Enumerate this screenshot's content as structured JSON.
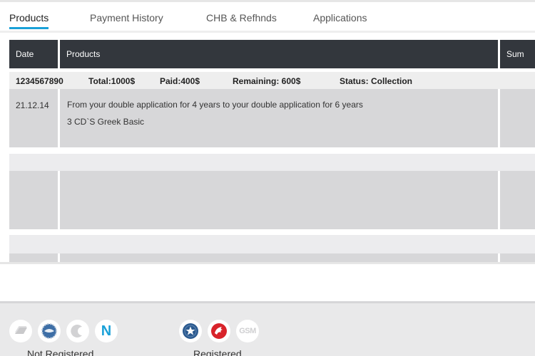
{
  "tabs": [
    {
      "label": "Products",
      "active": true
    },
    {
      "label": "Payment History",
      "active": false
    },
    {
      "label": "CHB & Refhnds",
      "active": false
    },
    {
      "label": "Applications",
      "active": false
    }
  ],
  "table": {
    "headers": {
      "date": "Date",
      "products": "Products",
      "sum": "Sum"
    },
    "summary": {
      "id": "1234567890",
      "total": "Total:1000$",
      "paid": "Paid:400$",
      "remaining": "Remaining: 600$",
      "status": "Status: Collection"
    },
    "rows": [
      {
        "date": "21.12.14",
        "line1": "From your double application for 4 years to your double application for 6 years",
        "line2": "3 CD`S Greek Basic"
      }
    ]
  },
  "footer": {
    "not_registered_label": "Not Registered",
    "registered_label": "Registered",
    "gsm_text": "GSM",
    "n_text": "N",
    "colors": {
      "accent": "#1aa1d8",
      "header_bg": "#33373d",
      "star_badge": "#2b5a8f",
      "red_badge": "#d8232a"
    }
  }
}
